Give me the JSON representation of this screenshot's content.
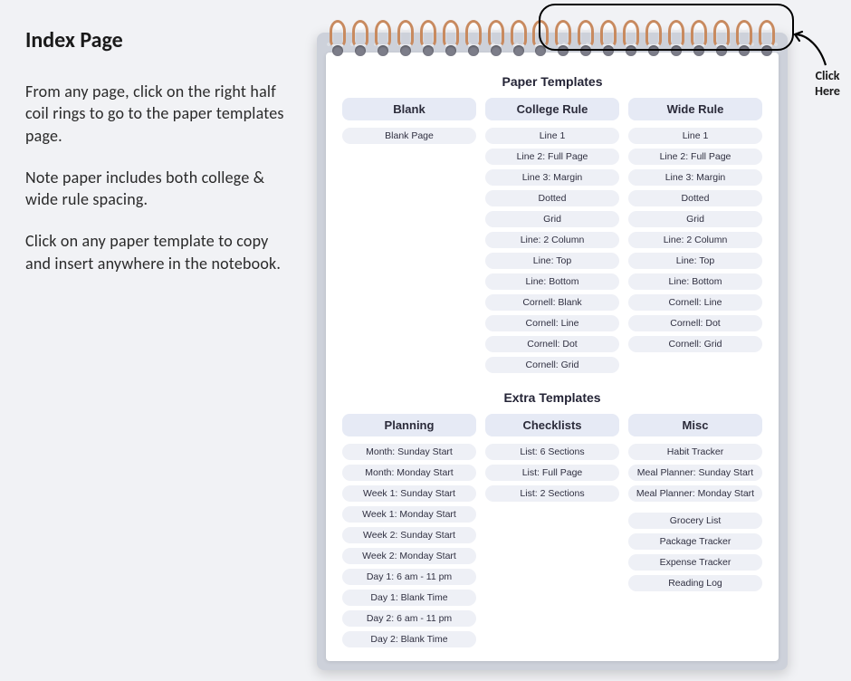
{
  "left": {
    "title": "Index Page",
    "p1": "From any page, click on the right half coil rings to go to the paper templates page.",
    "p2": "Note paper includes both college & wide rule spacing.",
    "p3": "Click on any paper tem­plate to copy and insert anywhere in the notebook."
  },
  "callout": {
    "label": "Click Here"
  },
  "sections": {
    "paper": {
      "title": "Paper Templates",
      "columns": [
        {
          "head": "Blank",
          "items": [
            "Blank Page"
          ]
        },
        {
          "head": "College Rule",
          "items": [
            "Line 1",
            "Line 2: Full Page",
            "Line 3: Margin",
            "Dotted",
            "Grid",
            "Line: 2 Column",
            "Line: Top",
            "Line: Bottom",
            "Cornell: Blank",
            "Cornell: Line",
            "Cornell: Dot",
            "Cornell: Grid"
          ]
        },
        {
          "head": "Wide Rule",
          "items": [
            "Line 1",
            "Line 2: Full Page",
            "Line 3: Margin",
            "Dotted",
            "Grid",
            "Line: 2 Column",
            "Line: Top",
            "Line: Bottom",
            "Cornell: Line",
            "Cornell: Dot",
            "Cornell: Grid"
          ]
        }
      ]
    },
    "extra": {
      "title": "Extra Templates",
      "columns": [
        {
          "head": "Planning",
          "items": [
            "Month: Sunday Start",
            "Month: Monday Start",
            "Week 1: Sunday Start",
            "Week 1: Monday Start",
            "Week 2: Sunday Start",
            "Week 2: Monday Start",
            "Day 1: 6 am - 11 pm",
            "Day 1: Blank Time",
            "Day 2: 6 am - 11 pm",
            "Day 2: Blank Time"
          ]
        },
        {
          "head": "Checklists",
          "items": [
            "List: 6 Sections",
            "List: Full Page",
            "List: 2 Sections"
          ]
        },
        {
          "head": "Misc",
          "items": [
            "Habit Tracker",
            "Meal Planner: Sunday  Start",
            "Meal Planner: Monday Start",
            "",
            "Grocery List",
            "Package Tracker",
            "Expense Tracker",
            "Reading Log"
          ]
        }
      ]
    }
  }
}
